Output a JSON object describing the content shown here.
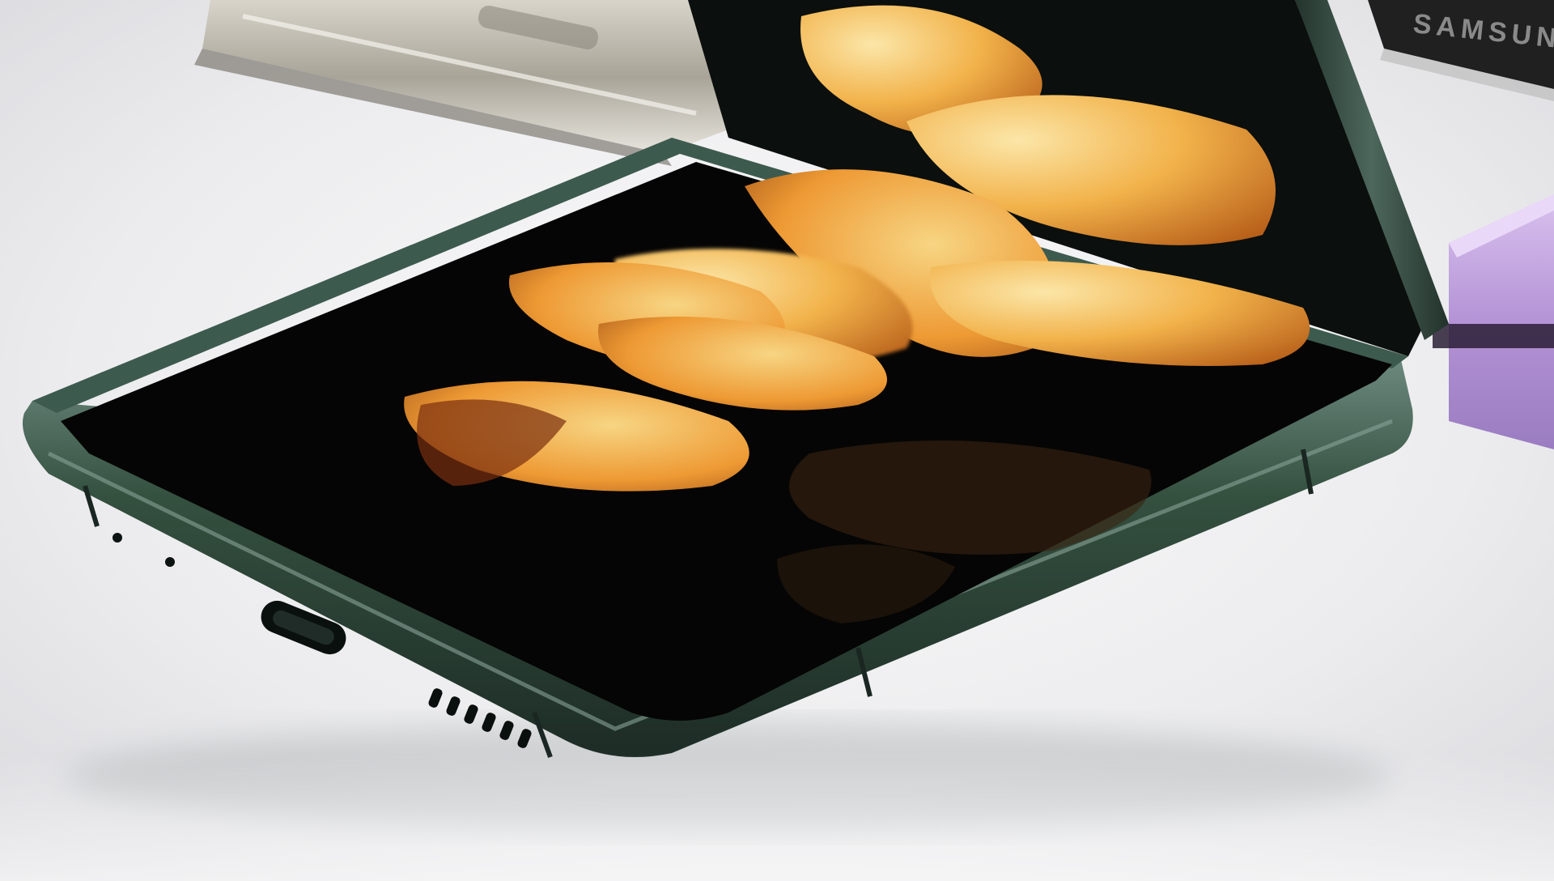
{
  "scene": {
    "description_type": "product-photo",
    "background_color": "#ececee",
    "colors": {
      "main_phone_frame": "#2b4038",
      "main_phone_frame_highlight": "#5f7a70",
      "screen": "#050505",
      "petal_light": "#f2d58a",
      "petal_mid": "#f0a63c",
      "petal_dark": "#c86a1c",
      "rear_phone_metal": "#bdb8ac",
      "right_phone_lavender": "#c4a6de"
    },
    "brand_text": "SAMSUNG",
    "icons": [
      "usb-c-port-icon",
      "speaker-grille-icon",
      "microphone-hole-icon"
    ]
  }
}
